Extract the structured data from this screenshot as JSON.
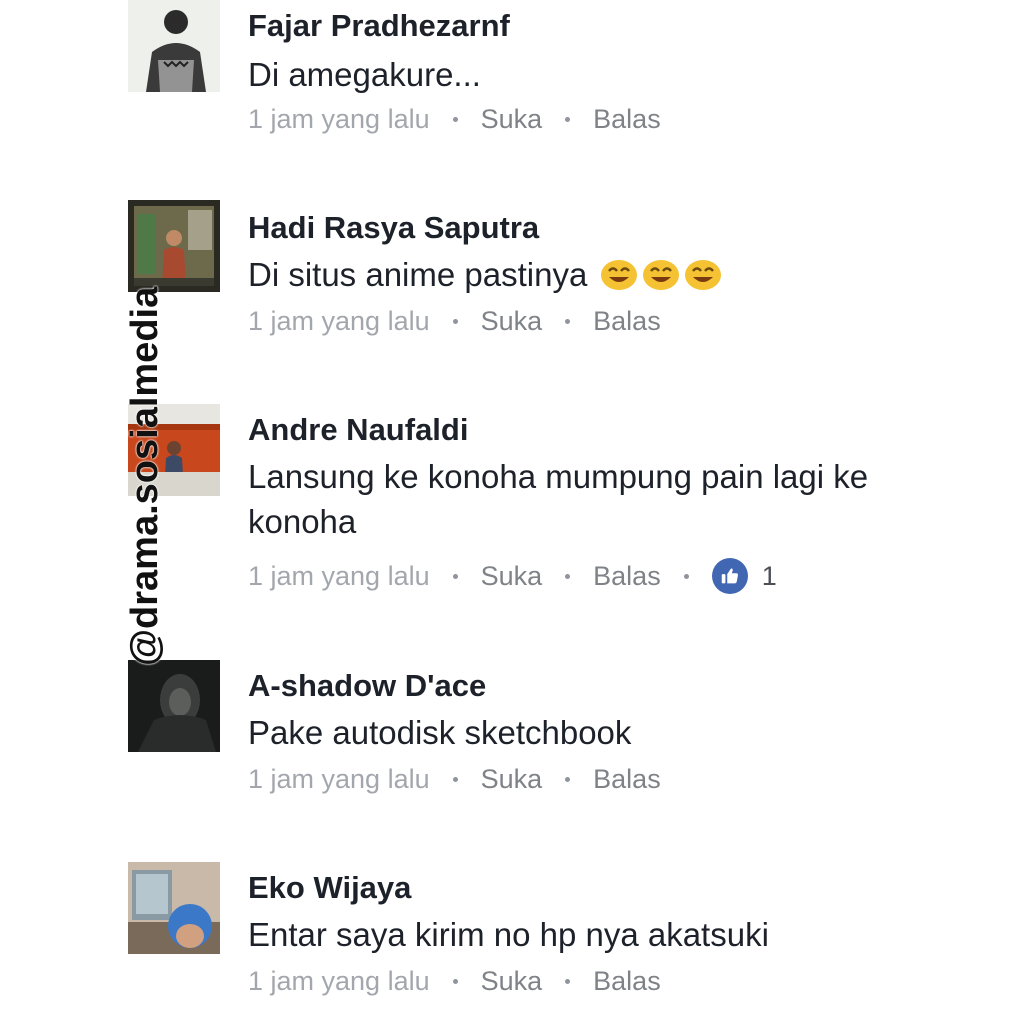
{
  "watermark": "@drama.sosialmedia",
  "comments": [
    {
      "author": "Fajar Pradhezarnf",
      "text": "Di amegakure...",
      "time": "1 jam yang lalu",
      "like_label": "Suka",
      "reply_label": "Balas"
    },
    {
      "author": "Hadi Rasya Saputra",
      "text": "Di situs anime pastinya",
      "emoji": [
        "laughing-emoji",
        "laughing-emoji",
        "laughing-emoji"
      ],
      "time": "1 jam yang lalu",
      "like_label": "Suka",
      "reply_label": "Balas"
    },
    {
      "author": "Andre Naufaldi",
      "text": "Lansung ke konoha mumpung pain lagi ke konoha",
      "time": "1 jam yang lalu",
      "like_label": "Suka",
      "reply_label": "Balas",
      "reaction_icon": "thumbs-up-icon",
      "reaction_count": "1"
    },
    {
      "author": "A-shadow D'ace",
      "text": "Pake autodisk sketchbook",
      "time": "1 jam yang lalu",
      "like_label": "Suka",
      "reply_label": "Balas"
    },
    {
      "author": "Eko Wijaya",
      "text": "Entar saya kirim no hp nya akatsuki",
      "time": "1 jam yang lalu",
      "like_label": "Suka",
      "reply_label": "Balas"
    }
  ],
  "colors": {
    "text": "#1d2129",
    "meta": "#90949c",
    "like_badge": "#4267b2"
  }
}
